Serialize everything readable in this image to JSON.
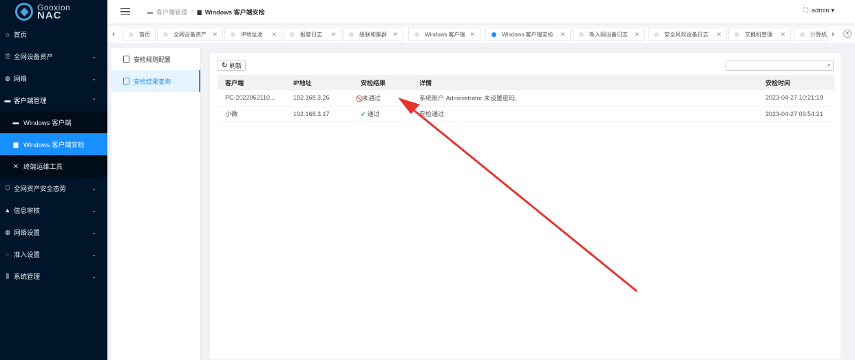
{
  "logo": {
    "line1": "Gooxion",
    "line2": "NAC"
  },
  "sidebar": {
    "items": [
      {
        "icon": "home-icon",
        "glyph": "⌂",
        "label": "首页",
        "chevron": ""
      },
      {
        "icon": "list-icon",
        "glyph": "☰",
        "label": "全网设备资产",
        "chevron": "⌄"
      },
      {
        "icon": "globe-icon",
        "glyph": "◍",
        "label": "网络",
        "chevron": "⌄"
      },
      {
        "icon": "monitor-icon",
        "glyph": "▬",
        "label": "客户端管理",
        "chevron": "⌃"
      },
      {
        "icon": "monitor-icon",
        "glyph": "▬",
        "label": "Windows 客户端",
        "chevron": ""
      },
      {
        "icon": "document-icon",
        "glyph": "▆",
        "label": "Windows 客户端安检",
        "chevron": ""
      },
      {
        "icon": "tools-icon",
        "glyph": "✕",
        "label": "终端运维工具",
        "chevron": ""
      },
      {
        "icon": "shield-icon",
        "glyph": "⛉",
        "label": "全网资产安全态势",
        "chevron": "⌄"
      },
      {
        "icon": "audit-icon",
        "glyph": "▲",
        "label": "信息审核",
        "chevron": "⌄"
      },
      {
        "icon": "network-settings-icon",
        "glyph": "◍",
        "label": "网络设置",
        "chevron": "⌄"
      },
      {
        "icon": "access-icon",
        "glyph": "◌",
        "label": "准入设置",
        "chevron": "⌄"
      },
      {
        "icon": "sliders-icon",
        "glyph": "⫼",
        "label": "系统管理",
        "chevron": "⌄"
      }
    ]
  },
  "header": {
    "breadcrumb_parent": "客户端管理",
    "breadcrumb_current": "Windows 客户端安检",
    "user": "admin ▾"
  },
  "tabs": [
    {
      "label": "首页",
      "closable": false
    },
    {
      "label": "全网设备资产",
      "closable": true
    },
    {
      "label": "IP地址池",
      "closable": true
    },
    {
      "label": "报警日志",
      "closable": true
    },
    {
      "label": "级联和集群",
      "closable": true
    },
    {
      "label": "Windows 客户端",
      "closable": true
    },
    {
      "label": "Windows 客户端安检",
      "closable": true,
      "active": true
    },
    {
      "label": "新入网设备日志",
      "closable": true
    },
    {
      "label": "安全风险设备日志",
      "closable": true
    },
    {
      "label": "交换机管理",
      "closable": true
    },
    {
      "label": "计算机",
      "closable": false
    }
  ],
  "subnav": {
    "items": [
      {
        "label": "安检规则配置"
      },
      {
        "label": "安检结果查询"
      }
    ]
  },
  "toolbar": {
    "refresh_label": "刷新",
    "search_placeholder": ""
  },
  "table": {
    "headers": [
      "客户端",
      "IP地址",
      "安检结果",
      "详情",
      "安检时间"
    ],
    "rows": [
      {
        "client": "PC-2022062110...",
        "ip": "192.168.3.26",
        "result_icon": "⃠",
        "result": "未通过",
        "detail": "系统账户 Administrator 未设置密码;",
        "time": "2023-04-27 10:21:19"
      },
      {
        "client": "小微",
        "ip": "192.168.3.17",
        "result_icon": "✔",
        "result": "通过",
        "detail": "安检通过",
        "time": "2023-04-27 09:54:21"
      }
    ]
  },
  "colors": {
    "accent": "#1890ff",
    "sidebar_bg": "#001529",
    "fail": "#e03b2f",
    "pass": "#2bb24c",
    "annotation": "#e8322e"
  }
}
